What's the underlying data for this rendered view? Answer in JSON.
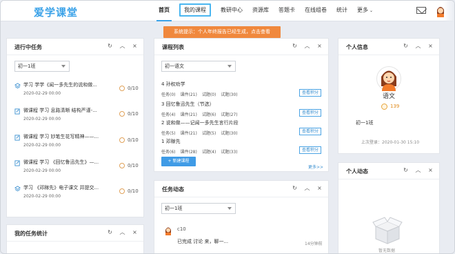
{
  "app": {
    "logo": "爱学课堂"
  },
  "nav": [
    {
      "label": "首页",
      "state": "active"
    },
    {
      "label": "我的课程",
      "state": "highlighted"
    },
    {
      "label": "教研中心",
      "state": ""
    },
    {
      "label": "资源库",
      "state": ""
    },
    {
      "label": "答题卡",
      "state": ""
    },
    {
      "label": "在线组卷",
      "state": ""
    },
    {
      "label": "统计",
      "state": ""
    },
    {
      "label": "更多",
      "state": ""
    }
  ],
  "notice": {
    "text": "系统提示：个人年终报告已经生成，点击查看",
    "color": "#f0883d"
  },
  "tasks_panel": {
    "title": "进行中任务",
    "class_select": "初一1班",
    "tasks": [
      {
        "name": "学习 学学《闻一多先生的说和做...",
        "date": "2020-02-29 00:00",
        "count": "0/10",
        "icon": "layers-icon"
      },
      {
        "name": "微课程 学习 息路清晰 结构严谨-...",
        "date": "2020-02-29 00:00",
        "count": "0/10",
        "icon": "doc-edit-icon"
      },
      {
        "name": "微课程 学习 妙笔生花写精神——...",
        "date": "2020-02-29 00:00",
        "count": "0/10",
        "icon": "doc-edit-icon"
      },
      {
        "name": "微课程 学习 《回忆鲁迅先生》—...",
        "date": "2020-02-29 00:00",
        "count": "0/10",
        "icon": "doc-edit-icon"
      },
      {
        "name": "学习 《邓稼先》电子课文 并提交...",
        "date": "2020-02-29 00:00",
        "count": "0/10",
        "icon": "layers-icon"
      }
    ]
  },
  "stats_panel": {
    "title": "我的任务统计"
  },
  "course_panel": {
    "title": "课程列表",
    "select": "初一语文",
    "courses": [
      {
        "name": "4 孙权劝学",
        "stats": [
          "任务(0)",
          "课件(21)",
          "试题(0)",
          "试题(30)"
        ],
        "button": "查看积分"
      },
      {
        "name": "3 回忆鲁迅先生（节选）",
        "stats": [
          "任务(4)",
          "课件(21)",
          "试题(6)",
          "试题(27)"
        ],
        "button": "查看积分"
      },
      {
        "name": "2 说和做——记闻一多先生言行片段",
        "stats": [
          "任务(5)",
          "课件(21)",
          "试题(5)",
          "试题(30)"
        ],
        "button": "查看积分"
      },
      {
        "name": "1 邓稼先",
        "stats": [
          "任务(6)",
          "课件(28)",
          "试题(4)",
          "试题(33)"
        ],
        "button": "查看积分"
      }
    ],
    "new_button": "+ 新建课程",
    "more": "更多>>"
  },
  "dynamics_panel": {
    "title": "任务动态",
    "select": "初一1班",
    "item": {
      "user": "c10",
      "text": "已完成 讨论 来，聊一...",
      "time": "14分钟前"
    }
  },
  "profile_panel": {
    "title": "个人信息",
    "subject": "语文",
    "points": "139",
    "class": "初一1班",
    "last_login": "上次登录：2020-01-30 15:10"
  },
  "personal_dyn_panel": {
    "title": "个人动态",
    "empty": "暂无数据"
  },
  "controls": {
    "refresh": "↻",
    "collapse": "︿",
    "close": "×"
  },
  "colors": {
    "accent": "#3aa2e8",
    "notice": "#f0883d",
    "points": "#e08a1a"
  }
}
